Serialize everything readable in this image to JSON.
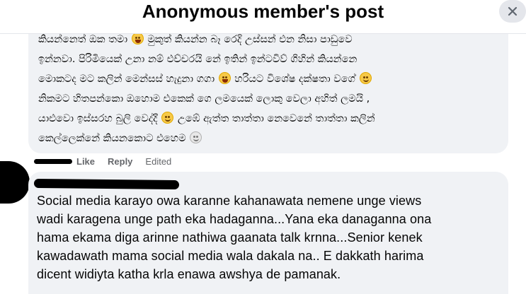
{
  "header": {
    "title": "Anonymous member's post",
    "close_icon": "close-icon"
  },
  "comment1": {
    "lines": [
      "කියන්නෙත් ඔක තමා",
      " මුකුත් කියන්න බෑ රෙදි උස්සන් එන නිසා පාඩුවෙ",
      "ඉන්නවා. පිරිමියෙක් උනා නම් එච්චරයි නේ ඉතින් ඉන්ටවිව් ගිහින් කියන්නෙ",
      "මොකටද මට කලින් මෙන්සස් හැදුනා ගගා",
      " හරියට විශේෂ දක්ෂතා වගේ",
      "නිකමට හිතපන්කො ඔහොම එකෙක් ගෙ ලමයෙක් ලොකු වෙලා අහිත් ලමයි ,",
      "යාළුවො ඉස්සරහ බුලි වෙද්දී",
      " උඹේ ඇත්ත තාත්තා නෙවෙනේ තාත්තා කලින්",
      "කෙල්ලෙක්නේ කියනකොට එහෙම"
    ],
    "emojis": {
      "laugh": "laughing-emoji",
      "smile": "smiling-emoji",
      "neutral": "neutral-face-emoji"
    }
  },
  "actions": {
    "like": "Like",
    "reply": "Reply",
    "edited": "Edited"
  },
  "comment2": {
    "lines": [
      "Social media karayo owa karanne kahanawata nemene unge views",
      "wadi karagena unge path eka hadaganna...Yana eka danaganna ona",
      "hama ekama diga arinne nathiwa gaanata talk krnna...Senior kenek",
      "kawadawath mama social media wala dakala na.. E dakkath harima",
      "dicent widiyta katha krla enawa awshya de pamanak."
    ]
  },
  "colors": {
    "bubble": "#f0f2f5",
    "meta_text": "#65676b",
    "close_button": "#e4e6eb"
  }
}
